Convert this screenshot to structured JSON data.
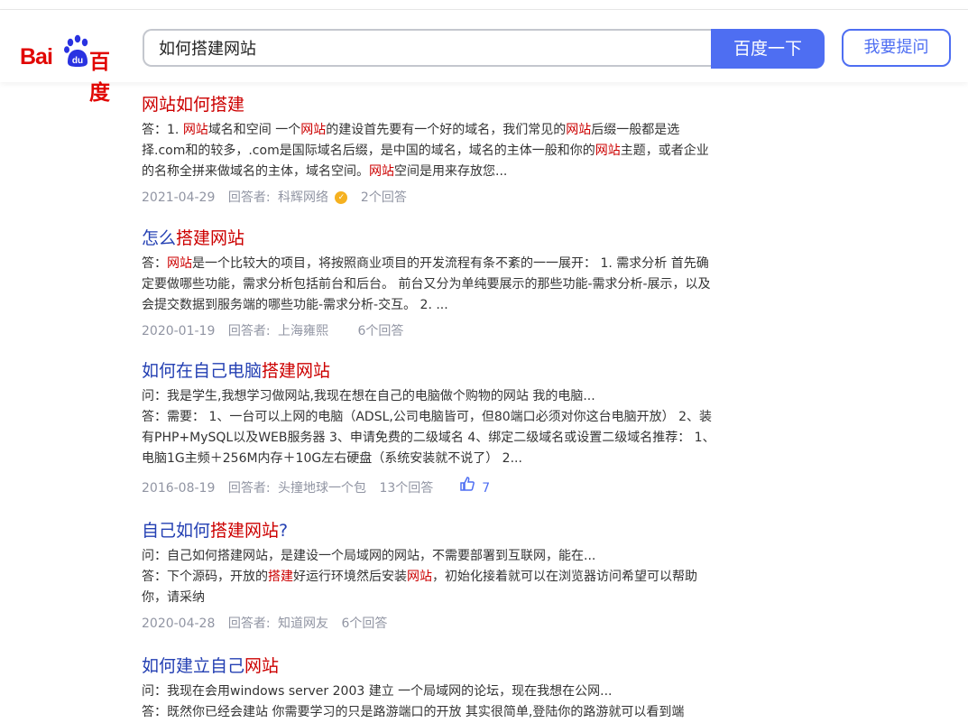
{
  "header": {
    "logo_latin": "Bai",
    "logo_du": "du",
    "logo_cn": "百度",
    "search_value": "如何搭建网站",
    "search_button": "百度一下",
    "ask_button": "我要提问"
  },
  "labels": {
    "answerer": "回答者:",
    "answer_prefix": "答：",
    "question_prefix": "问："
  },
  "results": [
    {
      "title": "网站如何搭建",
      "lines": [
        [
          "答：1. ",
          "网站",
          "域名和空间 一个",
          "网站",
          "的建设首先要有一个好的域名，我们常见的",
          "网站",
          "后缀一般都是选择.com和的较多，.com是国际域名后缀，是中国的域名，域名的主体一般和你的",
          "网站",
          "主题，或者企业的名称全拼来做域名的主体，域名空间。",
          "网站",
          "空间是用来存放您..."
        ]
      ],
      "date": "2021-04-29",
      "answerer_name": "科辉网络",
      "answer_count": "2个回答"
    },
    {
      "title_prefix": "怎么",
      "title_em": "搭建网站",
      "lines": [
        [
          "答：",
          "网站",
          "是一个比较大的项目，将按照商业项目的开发流程有条不紊的一一展开： 1. 需求分析 首先确定要做哪些功能，需求分析包括前台和后台。 前台又分为单纯要展示的那些功能-需求分析-展示，以及会提交数据到服务端的哪些功能-需求分析-交互。 2. ..."
        ]
      ],
      "date": "2020-01-19",
      "answerer_name": "上海雍熙",
      "answer_count": "6个回答"
    },
    {
      "title_prefix": "如何在自己电脑",
      "title_em": "搭建网站",
      "question": "问：我是学生,我想学习做网站,我现在想在自己的电脑做个购物的网站 我的电脑...",
      "answer": "答：需要： 1、一台可以上网的电脑（ADSL,公司电脑皆可，但80端口必须对你这台电脑开放） 2、装有PHP+MySQL以及WEB服务器 3、申请免费的二级域名 4、绑定二级域名或设置二级域名推荐： 1、电脑1G主频＋256M内存＋10G左右硬盘（系统安装就不说了） 2...",
      "date": "2016-08-19",
      "answerer_name": "头撞地球一个包",
      "answer_count": "13个回答",
      "likes": "7"
    },
    {
      "title_prefix": "自己如何",
      "title_em": "搭建网站",
      "title_suffix": "?",
      "question": "问：自己如何搭建网站，是建设一个局域网的网站，不需要部署到互联网，能在...",
      "answer_parts": [
        "答：下个源码，开放的",
        "搭建",
        "好运行环境然后安装",
        "网站",
        "，初始化接着就可以在浏览器访问希望可以帮助你，请采纳"
      ],
      "date": "2020-04-28",
      "answerer_name": "知道网友",
      "answer_count": "6个回答"
    },
    {
      "title_prefix": "如何建立自己",
      "title_em": "网站",
      "question": "问：我现在会用windows server 2003 建立 一个局域网的论坛，现在我想在公网...",
      "answer": "答：既然你已经会建站 你需要学习的只是路游端口的开放 其实很简单,登陆你的路游就可以看到端"
    }
  ]
}
